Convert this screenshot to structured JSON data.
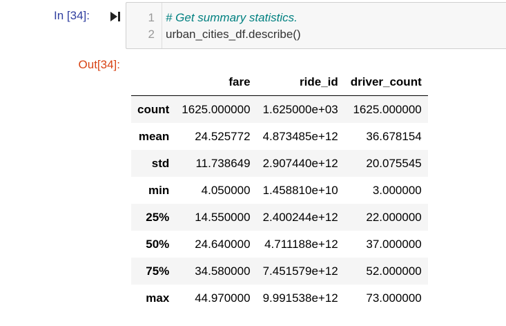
{
  "input_prompt": "In [34]:",
  "output_prompt": "Out[34]:",
  "code_cell": {
    "line_numbers": [
      "1",
      "2"
    ],
    "comment_line": "# Get summary statistics.",
    "code_line": "urban_cities_df.describe()"
  },
  "table": {
    "columns": [
      "fare",
      "ride_id",
      "driver_count"
    ],
    "rows": [
      {
        "label": "count",
        "values": [
          "1625.000000",
          "1.625000e+03",
          "1625.000000"
        ]
      },
      {
        "label": "mean",
        "values": [
          "24.525772",
          "4.873485e+12",
          "36.678154"
        ]
      },
      {
        "label": "std",
        "values": [
          "11.738649",
          "2.907440e+12",
          "20.075545"
        ]
      },
      {
        "label": "min",
        "values": [
          "4.050000",
          "1.458810e+10",
          "3.000000"
        ]
      },
      {
        "label": "25%",
        "values": [
          "14.550000",
          "2.400244e+12",
          "22.000000"
        ]
      },
      {
        "label": "50%",
        "values": [
          "24.640000",
          "4.711188e+12",
          "37.000000"
        ]
      },
      {
        "label": "75%",
        "values": [
          "34.580000",
          "7.451579e+12",
          "52.000000"
        ]
      },
      {
        "label": "max",
        "values": [
          "44.970000",
          "9.991538e+12",
          "73.000000"
        ]
      }
    ]
  },
  "colors": {
    "input_prompt": "#303f9f",
    "output_prompt": "#d84315",
    "comment": "#008080",
    "row_stripe": "#f5f5f5"
  }
}
